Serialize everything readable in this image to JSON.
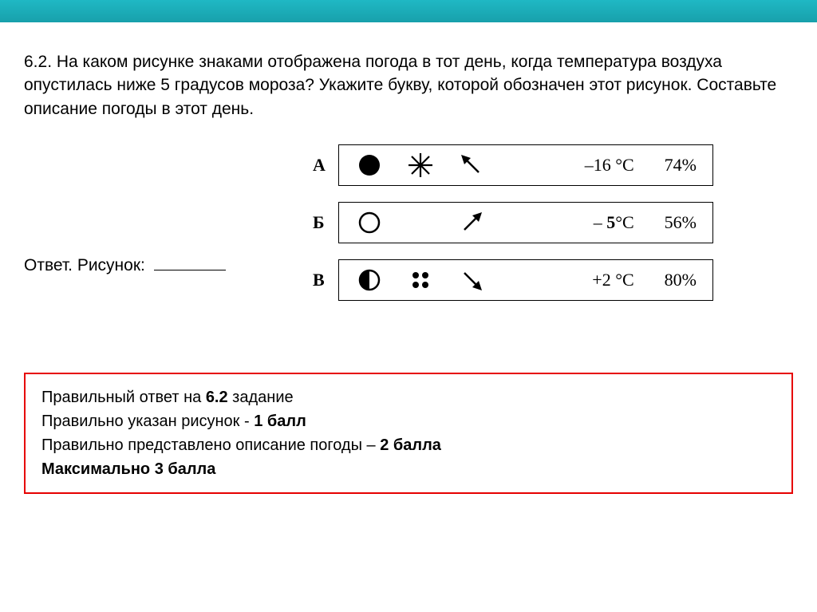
{
  "question": {
    "number": "6.2.",
    "text": "На каком рисунке знаками отображена погода в тот день, когда температура воздуха опустилась ниже 5 градусов мороза? Укажите букву, которой обозначен этот рисунок. Составьте описание погоды в этот день."
  },
  "answer_label": "Ответ. Рисунок:",
  "rows": [
    {
      "letter": "А",
      "temp": "–16 °C",
      "humidity": "74%"
    },
    {
      "letter": "Б",
      "temp_prefix": "– ",
      "temp_bold": "5",
      "temp_suffix": "°C",
      "humidity": "56%"
    },
    {
      "letter": "В",
      "temp": "+2 °C",
      "humidity": "80%"
    }
  ],
  "scoring": {
    "line1_a": "Правильный ответ на ",
    "line1_b": "6.2",
    "line1_c": " задание",
    "line2_a": "Правильно указан рисунок - ",
    "line2_b": "1 балл",
    "line3_a": "Правильно представлено описание погоды – ",
    "line3_b": "2 балла",
    "line4": "Максимально 3 балла"
  }
}
